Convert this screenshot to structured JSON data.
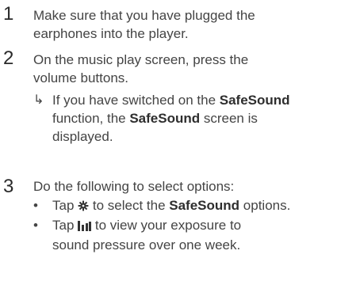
{
  "steps": [
    {
      "number": "1",
      "line1": "Make sure that you have plugged the",
      "line2": "earphones into the player."
    },
    {
      "number": "2",
      "line1": "On the music play screen, press the",
      "line2": "volume buttons.",
      "result": {
        "a": "If you have switched on the ",
        "b": "SafeSound",
        "c": "function, the ",
        "d": "SafeSound",
        "e": " screen is",
        "f": "displayed."
      }
    },
    {
      "number": "3",
      "line1": "Do the following to select options:",
      "bullets": [
        {
          "a": "Tap ",
          "icon": "gear-icon",
          "b": " to select the ",
          "c": "SafeSound",
          "d": " options."
        },
        {
          "a": "Tap ",
          "icon": "bar-chart-icon",
          "b": " to view your exposure to",
          "c": "sound pressure over one week."
        }
      ]
    }
  ]
}
